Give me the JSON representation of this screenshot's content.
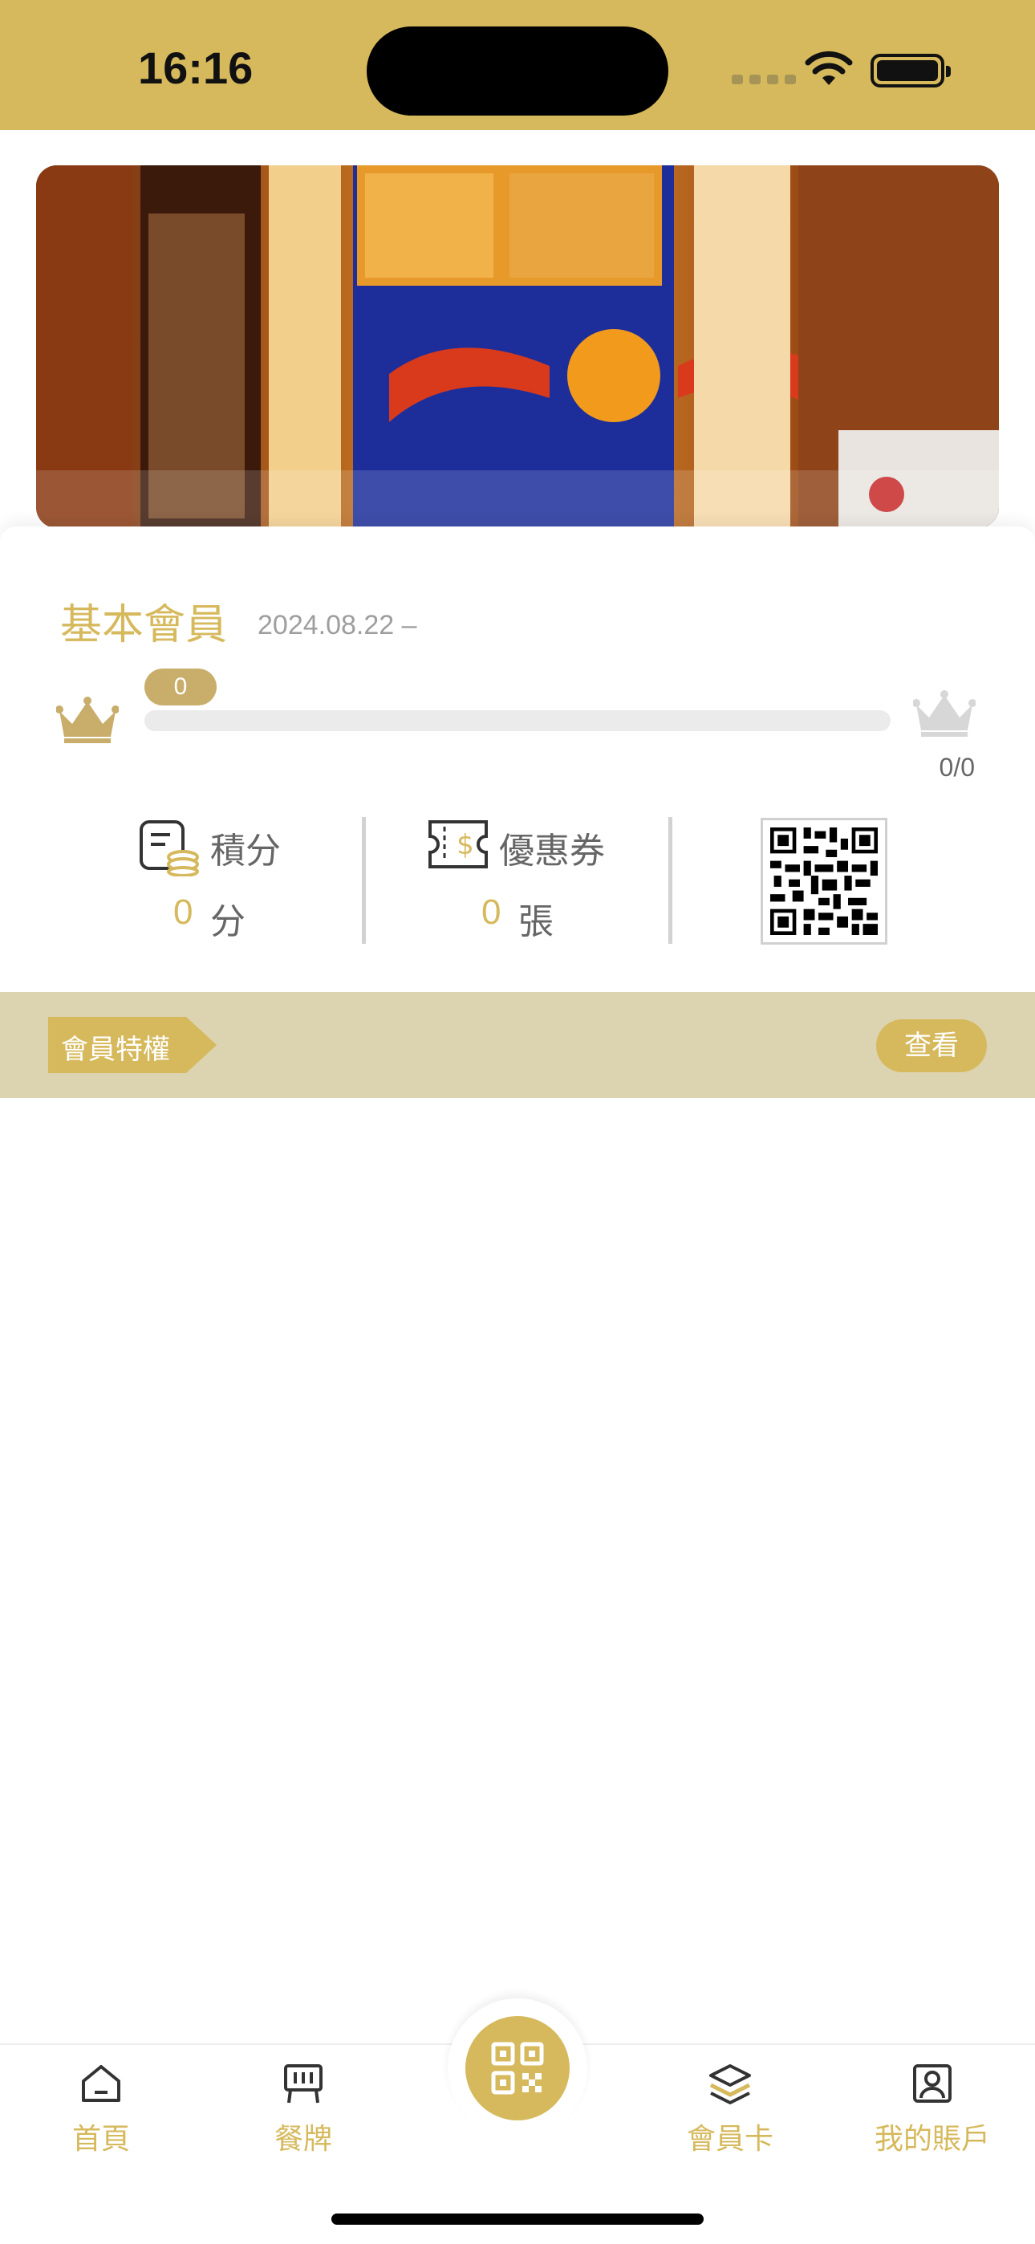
{
  "status_bar": {
    "time": "16:16"
  },
  "member": {
    "tier_name": "基本會員",
    "since": "2024.08.22 –",
    "progress_value": "0",
    "progress_count": "0/0"
  },
  "stats": {
    "points_label": "積分",
    "points_value": "0",
    "points_unit": "分",
    "coupons_label": "優惠券",
    "coupons_value": "0",
    "coupons_unit": "張"
  },
  "privileges": {
    "title": "會員特權",
    "view_label": "查看"
  },
  "tabbar": {
    "items": [
      {
        "label": "首頁",
        "icon": "home-icon"
      },
      {
        "label": "餐牌",
        "icon": "menu-board-icon"
      },
      {
        "label": "",
        "icon": "qr-code-icon"
      },
      {
        "label": "會員卡",
        "icon": "layers-icon"
      },
      {
        "label": "我的賬戶",
        "icon": "account-icon"
      }
    ]
  },
  "colors": {
    "brand_gold": "#d6b95c",
    "privilege_bar": "#dcd3b0",
    "muted_text": "#9e9e9e"
  }
}
